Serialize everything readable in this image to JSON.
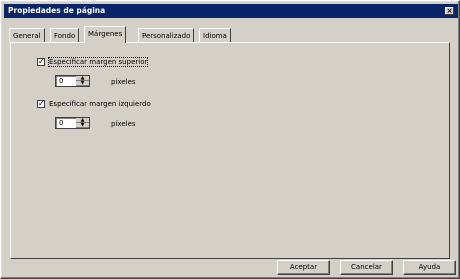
{
  "window": {
    "title": "Propiedades de página",
    "close_glyph": "×"
  },
  "tabs": [
    {
      "label": "General"
    },
    {
      "label": "Fondo"
    },
    {
      "label": "Márgenes",
      "active": true
    },
    {
      "label": "Personalizado"
    },
    {
      "label": "Idioma"
    }
  ],
  "margins": {
    "top": {
      "label": "Especificar margen superior",
      "checked": true,
      "value": "0",
      "unit": "píxeles"
    },
    "left": {
      "label": "Especificar margen izquierdo",
      "checked": true,
      "value": "0",
      "unit": "píxeles"
    }
  },
  "buttons": {
    "ok": "Aceptar",
    "cancel": "Cancelar",
    "help": "Ayuda"
  },
  "colors": {
    "titlebar": "#0a246a",
    "face": "#d4d0c8"
  }
}
